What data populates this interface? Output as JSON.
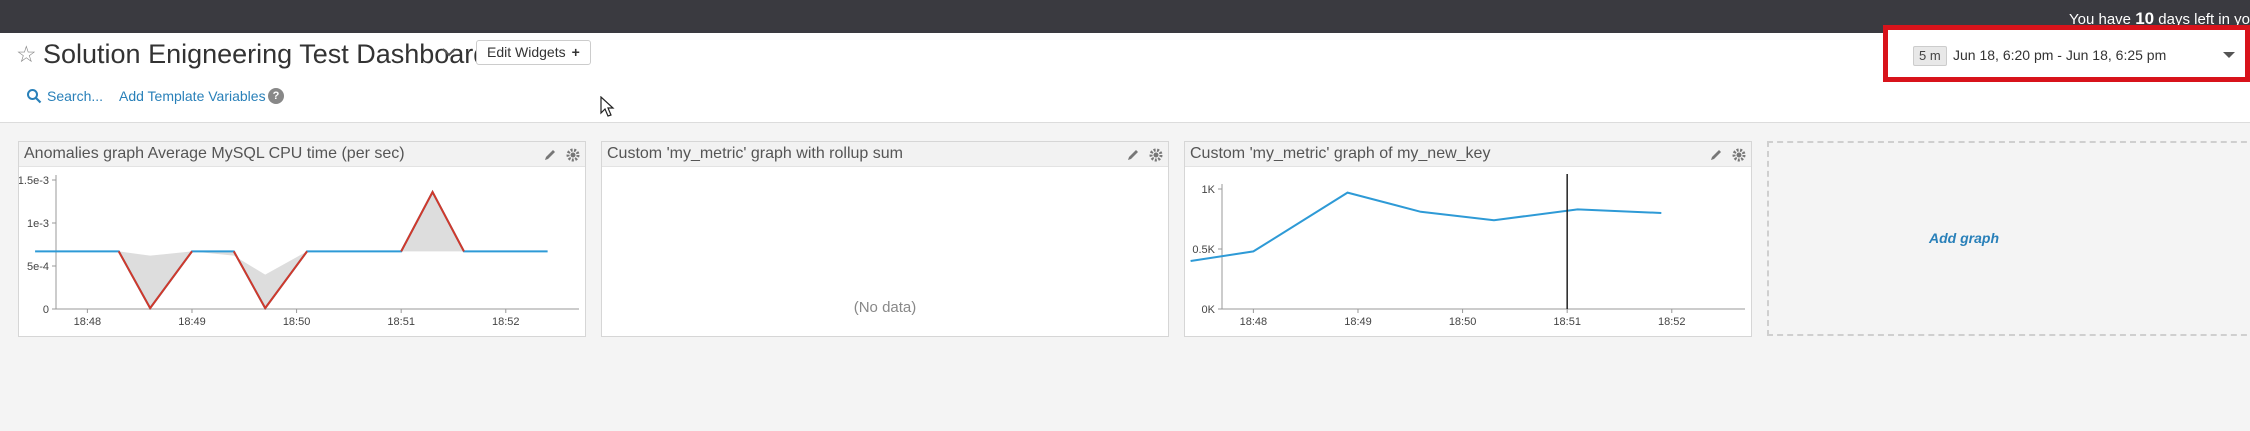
{
  "topbar": {
    "trial_prefix": "You have",
    "trial_days": "10",
    "trial_suffix": "days left in yo"
  },
  "header": {
    "title": "Solution Enigneering Test Dashboard",
    "edit_widgets_label": "Edit Widgets",
    "edit_widgets_icon": "+",
    "search_label": "Search...",
    "template_vars_label": "Add Template Variables",
    "help_icon_glyph": "?"
  },
  "timepicker": {
    "badge": "5 m",
    "range": "Jun 18, 6:20 pm - Jun 18, 6:25 pm"
  },
  "widgets": [
    {
      "title": "Anomalies graph Average MySQL CPU time (per sec)"
    },
    {
      "title": "Custom 'my_metric' graph with rollup sum",
      "empty_text": "(No data)"
    },
    {
      "title": "Custom 'my_metric' graph of my_new_key"
    }
  ],
  "add_graph_label": "Add graph",
  "colors": {
    "series_blue": "#2e9ad6",
    "anomaly_red": "#d0392b",
    "band_grey": "#dddddd",
    "highlight_red": "#d8131b",
    "link_blue": "#2980b9"
  },
  "chart_data": [
    {
      "type": "line",
      "title": "Anomalies graph Average MySQL CPU time (per sec)",
      "x_ticks": [
        "18:48",
        "18:49",
        "18:50",
        "18:51",
        "18:52"
      ],
      "y_ticks": [
        "0",
        "5e-4",
        "1e-3",
        "1.5e-3"
      ],
      "ylim": [
        0,
        0.0015
      ],
      "x": [
        "18:47.5",
        "18:48.3",
        "18:48.6",
        "18:49.0",
        "18:49.4",
        "18:49.7",
        "18:50.1",
        "18:50.6",
        "18:51.0",
        "18:51.3",
        "18:51.6",
        "18:52.4"
      ],
      "series": [
        {
          "values": [
            0.00067,
            0.00067,
            1e-05,
            0.00067,
            0.00067,
            1e-05,
            0.00067,
            0.00067,
            0.00067,
            0.00136,
            0.00067,
            0.00067
          ]
        }
      ],
      "anomaly_segments": [
        [
          1,
          3
        ],
        [
          4,
          6
        ],
        [
          8,
          10
        ]
      ],
      "band": {
        "lower": [
          0.00067,
          0.00067,
          0.00062,
          0.00067,
          0.00062,
          0.0004,
          0.00067,
          0.00067,
          0.00067,
          0.00067,
          0.00067,
          0.00067
        ]
      },
      "grid": false
    },
    {
      "type": "line",
      "title": "Custom 'my_metric' graph of my_new_key",
      "x_ticks": [
        "18:48",
        "18:49",
        "18:50",
        "18:51",
        "18:52"
      ],
      "y_ticks": [
        "0K",
        "0.5K",
        "1K"
      ],
      "ylim": [
        0,
        1000
      ],
      "x": [
        "18:47.4",
        "18:48.0",
        "18:48.9",
        "18:49.6",
        "18:50.3",
        "18:51.1",
        "18:51.9"
      ],
      "series": [
        {
          "values": [
            400,
            480,
            970,
            810,
            740,
            830,
            800
          ]
        }
      ],
      "marker_x": "18:51",
      "grid": false
    }
  ]
}
